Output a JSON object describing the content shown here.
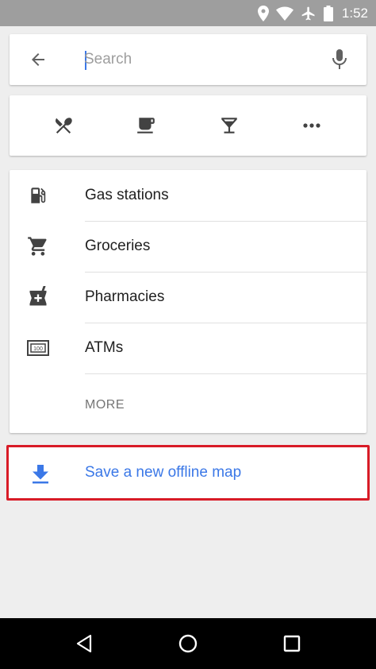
{
  "status_bar": {
    "time": "1:52",
    "icons": [
      "location-icon",
      "wifi-icon",
      "airplane-icon",
      "battery-icon"
    ]
  },
  "search": {
    "placeholder": "Search",
    "value": "",
    "back_icon": "arrow-back-icon",
    "mic_icon": "mic-icon"
  },
  "categories": [
    {
      "icon": "restaurant-icon",
      "label": "Restaurants"
    },
    {
      "icon": "coffee-icon",
      "label": "Coffee"
    },
    {
      "icon": "bar-icon",
      "label": "Bars"
    },
    {
      "icon": "more-horiz-icon",
      "label": "More"
    }
  ],
  "list": {
    "items": [
      {
        "icon": "gas-station-icon",
        "label": "Gas stations"
      },
      {
        "icon": "shopping-cart-icon",
        "label": "Groceries"
      },
      {
        "icon": "pharmacy-icon",
        "label": "Pharmacies"
      },
      {
        "icon": "atm-icon",
        "label": "ATMs"
      }
    ],
    "more_label": "MORE"
  },
  "offline": {
    "label": "Save a new offline map",
    "icon": "download-icon",
    "accent_color": "#3b78e7",
    "highlight_color": "#d81b27"
  },
  "nav_bar": {
    "buttons": [
      "back-triangle-icon",
      "home-circle-icon",
      "recents-square-icon"
    ]
  }
}
